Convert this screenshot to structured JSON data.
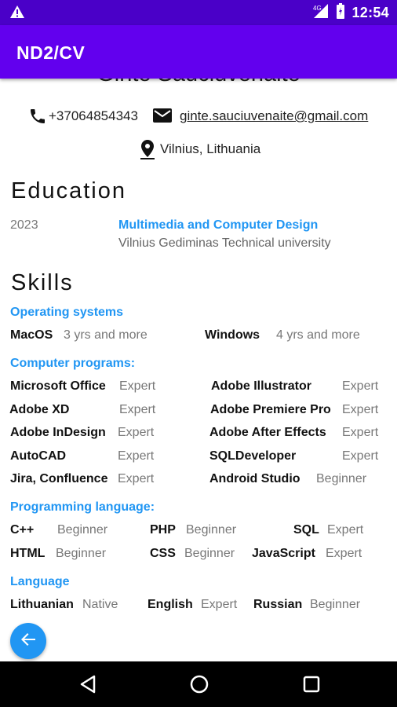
{
  "status_bar": {
    "time": "12:54",
    "icons": [
      "warning-icon",
      "signal-icon",
      "battery-icon"
    ]
  },
  "app_bar": {
    "title": "ND2/CV"
  },
  "profile": {
    "name": "Ginte Sauciuvenaite",
    "phone": "+37064854343",
    "email": "ginte.sauciuvenaite@gmail.com",
    "location": "Vilnius, Lithuania"
  },
  "education": {
    "title": "Education",
    "entries": [
      {
        "year": "2023",
        "degree": "Multimedia and Computer Design",
        "school": "Vilnius Gediminas Technical university"
      }
    ]
  },
  "skills": {
    "title": "Skills",
    "operating_systems": {
      "label": "Operating systems",
      "items": [
        {
          "name": "MacOS",
          "level": "3 yrs and more"
        },
        {
          "name": "Windows",
          "level": "4 yrs and more"
        }
      ]
    },
    "computer_programs": {
      "label": "Computer programs:",
      "items": [
        {
          "name": "Microsoft Office",
          "level": "Expert"
        },
        {
          "name": "Adobe Illustrator",
          "level": "Expert"
        },
        {
          "name": "Adobe XD",
          "level": "Expert"
        },
        {
          "name": "Adobe Premiere Pro",
          "level": "Expert"
        },
        {
          "name": "Adobe InDesign",
          "level": "Expert"
        },
        {
          "name": "Adobe After Effects",
          "level": "Expert"
        },
        {
          "name": "AutoCAD",
          "level": "Expert"
        },
        {
          "name": "SQLDeveloper",
          "level": "Expert"
        },
        {
          "name": "Jira, Confluence",
          "level": "Expert"
        },
        {
          "name": "Android Studio",
          "level": "Beginner"
        }
      ]
    },
    "programming_languages": {
      "label": "Programming language:",
      "items": [
        {
          "name": "C++",
          "level": "Beginner"
        },
        {
          "name": "PHP",
          "level": "Beginner"
        },
        {
          "name": "SQL",
          "level": "Expert"
        },
        {
          "name": "HTML",
          "level": "Beginner"
        },
        {
          "name": "CSS",
          "level": "Beginner"
        },
        {
          "name": "JavaScript",
          "level": "Expert"
        }
      ]
    },
    "languages": {
      "label": "Language",
      "items": [
        {
          "name": "Lithuanian",
          "level": "Native"
        },
        {
          "name": "English",
          "level": "Expert"
        },
        {
          "name": "Russian",
          "level": "Beginner"
        }
      ]
    }
  },
  "fab": {
    "icon": "arrow-left-icon"
  },
  "nav_bar": {
    "icons": [
      "back-icon",
      "home-icon",
      "recents-icon"
    ]
  },
  "colors": {
    "status_bar": "#4a00c8",
    "app_bar": "#6200ee",
    "accent": "#2196f3",
    "nav_bar": "#000000"
  }
}
